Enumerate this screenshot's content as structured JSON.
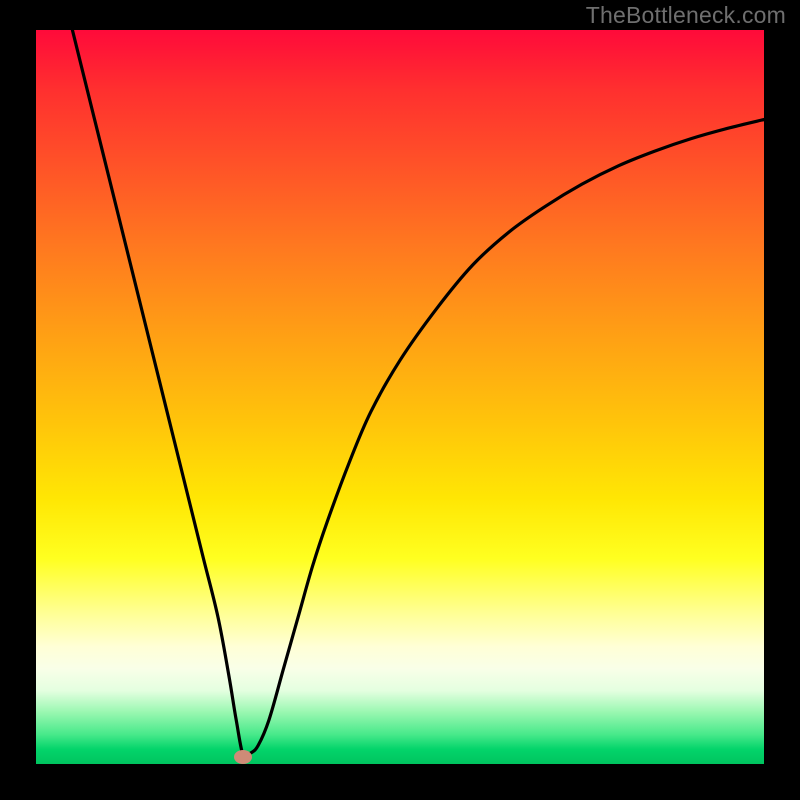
{
  "attribution": "TheBottleneck.com",
  "colors": {
    "frame": "#000000",
    "attribution": "#6f6f6f",
    "curve": "#000000",
    "marker": "#cf8b77",
    "gradient_top": "#ff0a3a",
    "gradient_bottom": "#00c45f"
  },
  "chart_data": {
    "type": "line",
    "title": "",
    "xlabel": "",
    "ylabel": "",
    "xlim": [
      0,
      100
    ],
    "ylim": [
      0,
      100
    ],
    "marker": {
      "x": 28.5,
      "y": 1.0
    },
    "series": [
      {
        "name": "bottleneck-curve",
        "x": [
          5,
          7,
          9,
          11,
          13,
          15,
          17,
          19,
          21,
          23,
          25,
          26.5,
          27.5,
          28.5,
          29.5,
          30.5,
          32,
          34,
          36,
          38,
          40,
          43,
          46,
          50,
          55,
          60,
          65,
          70,
          75,
          80,
          85,
          90,
          95,
          100
        ],
        "y": [
          100,
          92,
          84,
          76,
          68,
          60,
          52,
          44,
          36,
          28,
          20,
          12,
          6,
          1,
          1.5,
          2.5,
          6,
          13,
          20,
          27,
          33,
          41,
          48,
          55,
          62,
          68,
          72.5,
          76,
          79,
          81.5,
          83.5,
          85.2,
          86.6,
          87.8
        ]
      }
    ],
    "notes": "V-shaped curve with sharp minimum near x≈28; right branch rises asymptotically. Background is a vertical red→yellow→green gradient."
  }
}
